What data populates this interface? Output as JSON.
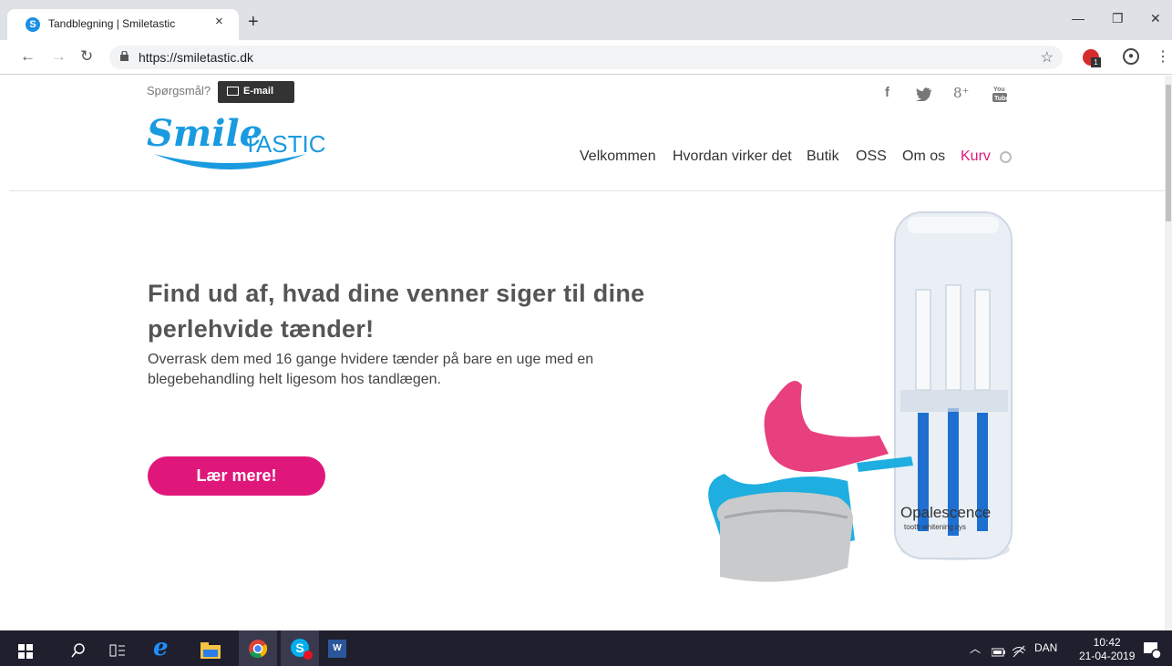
{
  "browser": {
    "tab_title": "Tandblegning | Smiletastic",
    "tab_close": "×",
    "new_tab": "+",
    "url": "https://smiletastic.dk",
    "ext_badge": "1"
  },
  "site": {
    "question_label": "Spørgsmål?",
    "email_label": "E-mail",
    "logo_smile": "Smile",
    "logo_tastic": "TASTIC",
    "social": [
      "f",
      "8⁺"
    ],
    "nav": [
      "Velkommen",
      "Hvordan virker det",
      "Butik",
      "OSS",
      "Om os",
      "Kurv"
    ],
    "headline": "Find ud af, hvad dine venner siger til dine perlehvide tænder!",
    "subtext": "Overrask dem med 16 gange hvidere tænder på bare en uge med en blegebehandling helt ligesom hos tandlægen.",
    "cta": "Lær mere!",
    "product_brand": "Opalescence",
    "product_tagline": "tooth whitening sys"
  },
  "taskbar": {
    "language": "DAN",
    "time": "10:42",
    "date": "21-04-2019"
  },
  "colors": {
    "brand_blue": "#1a9be0",
    "brand_pink": "#e0177b"
  }
}
